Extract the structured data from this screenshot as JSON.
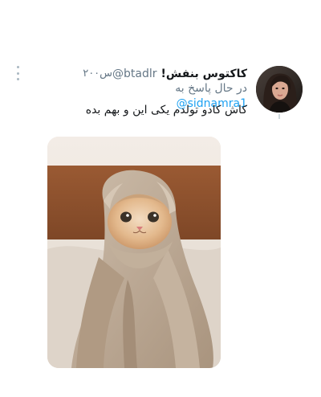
{
  "tweet": {
    "display_name": "کاکتوس بنفش!",
    "handle": "@btadlr",
    "time": "۲۰۰س",
    "reply_prefix": "در حال پاسخ به",
    "reply_to": "@sidnamra1",
    "text": "کاش کادو تولدم یکی این و بهم بده"
  },
  "icons": {
    "more": "more-vertical-icon"
  },
  "colors": {
    "name_text": "#14171a",
    "secondary_text": "#657786",
    "mention": "#1da1f2"
  }
}
